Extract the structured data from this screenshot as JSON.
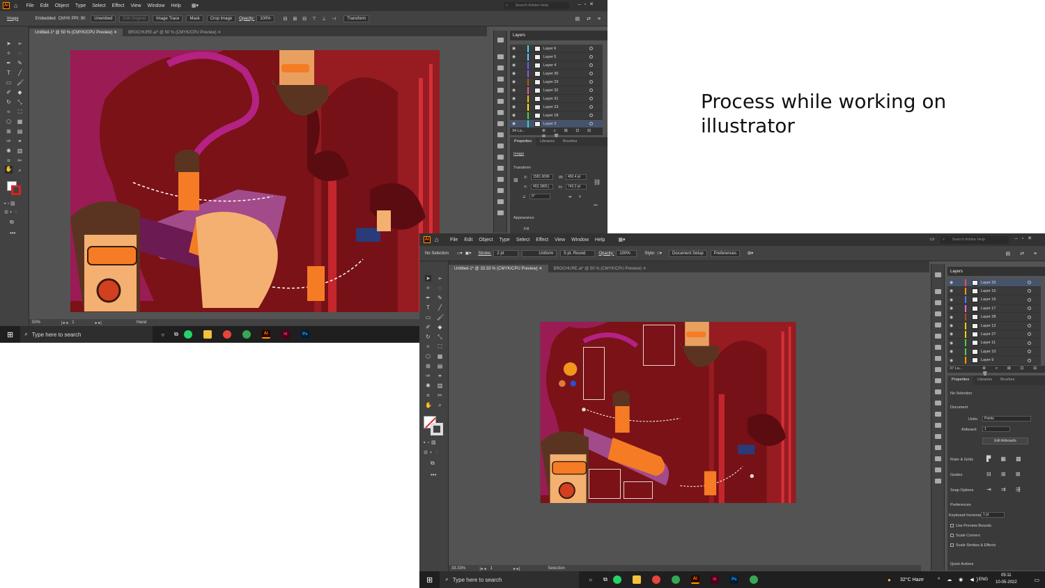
{
  "caption": "Process while working on illustrator",
  "menu": [
    "File",
    "Edit",
    "Object",
    "Type",
    "Select",
    "Effect",
    "View",
    "Window",
    "Help"
  ],
  "app_badge": "Ai",
  "help_placeholder": "Search Adobe Help",
  "shot1": {
    "ctrl": {
      "mode": "Image",
      "embedded": "Embedded",
      "info": "CMYK  PPI: 90",
      "unembed": "Unembed",
      "edit_original": "Edit Original",
      "image_trace": "Image Trace",
      "mask": "Mask",
      "crop": "Crop Image",
      "opacity_label": "Opacity:",
      "opacity": "100%",
      "transform": "Transform"
    },
    "tabs": [
      "Untitled-1* @ 50 % (CMYK/CPU Preview)",
      "BROCHURE.ai* @ 50 % (CMYK/CPU Preview)"
    ],
    "layers_title": "Layers",
    "layers": [
      {
        "name": "Layer 6",
        "color": "#4ad2ff"
      },
      {
        "name": "Layer 5",
        "color": "#4ad2ff"
      },
      {
        "name": "Layer 4",
        "color": "#6a5cff"
      },
      {
        "name": "Layer 30",
        "color": "#9d4cff"
      },
      {
        "name": "Layer 29",
        "color": "#9a6a00"
      },
      {
        "name": "Layer 32",
        "color": "#ff4da6"
      },
      {
        "name": "Layer 31",
        "color": "#ffbf00"
      },
      {
        "name": "Layer 23",
        "color": "#ffea00"
      },
      {
        "name": "Layer 18",
        "color": "#47d147"
      },
      {
        "name": "Layer 3",
        "color": "#3bd1c8"
      }
    ],
    "layers_count": "34 La...",
    "prop_tabs": [
      "Properties",
      "Libraries",
      "Brushes"
    ],
    "prop_kind": "Image",
    "transform_label": "Transform",
    "x_label": "X:",
    "x": "1581.0096",
    "y_label": "Y:",
    "y": "453.1865 j",
    "w_label": "W:",
    "w": "450.4 pt",
    "h_label": "H:",
    "h": "743.2 pt",
    "angle": "0°",
    "appearance": "Appearance",
    "fill": "Fill",
    "zoom": "50%",
    "page": "1",
    "status_tool": "Hand",
    "taskbar_search": "Type here to search"
  },
  "shot2": {
    "ctrl": {
      "selection": "No Selection",
      "stroke_label": "Stroke:",
      "stroke": "2 pt",
      "uniform": "Uniform",
      "brush": "5 pt. Round",
      "opacity_label": "Opacity:",
      "opacity": "100%",
      "style_label": "Style:",
      "doc_setup": "Document Setup",
      "prefs": "Preferences"
    },
    "tabs": [
      "Untitled-1* @ 33.33 % (CMYK/CPU Preview)",
      "BROCHURE.ai* @ 50 % (CMYK/CPU Preview)"
    ],
    "layers_title": "Layers",
    "layers": [
      {
        "name": "Layer 33",
        "color": "#ff4d4d"
      },
      {
        "name": "Layer 15",
        "color": "#ff9a00"
      },
      {
        "name": "Layer 16",
        "color": "#4d7cff"
      },
      {
        "name": "Layer 17",
        "color": "#ff66cc"
      },
      {
        "name": "Layer 28",
        "color": "#a0522d"
      },
      {
        "name": "Layer 12",
        "color": "#ffd000"
      },
      {
        "name": "Layer 27",
        "color": "#ffd000"
      },
      {
        "name": "Layer 11",
        "color": "#47d147"
      },
      {
        "name": "Layer 10",
        "color": "#47d147"
      },
      {
        "name": "Layer 9",
        "color": "#ff9a00"
      }
    ],
    "layers_count": "37 La...",
    "prop_tabs": [
      "Properties",
      "Libraries",
      "Brushes"
    ],
    "no_selection": "No Selection",
    "document": "Document",
    "units_label": "Units:",
    "units": "Points",
    "artboard_label": "Artboard:",
    "artboard": "1",
    "edit_artboards": "Edit Artboards",
    "rulers": "Ruler & Grids",
    "guides": "Guides",
    "snap": "Snap Options",
    "preferences": "Preferences",
    "kb_label": "Keyboard Increment:",
    "kb": "1 pt",
    "checks": [
      "Use Preview Bounds",
      "Scale Corners",
      "Scale Strokes & Effects"
    ],
    "quick": "Quick Actions",
    "zoom": "33.33%",
    "page": "1",
    "status_tool": "Selection",
    "taskbar_search": "Type here to search",
    "weather": "32°C  Haze",
    "lang": "ENG",
    "time": "05:11",
    "date": "10-05-2022"
  }
}
